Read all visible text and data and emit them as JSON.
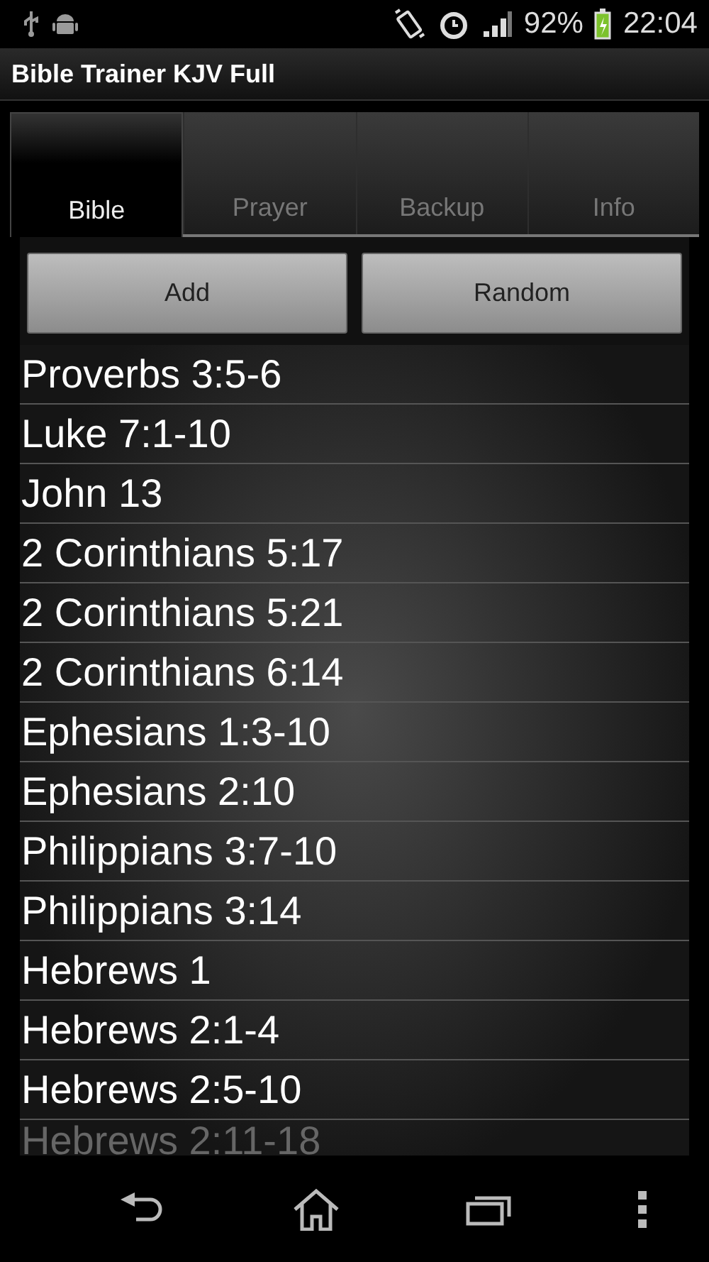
{
  "status_bar": {
    "battery": "92%",
    "time": "22:04"
  },
  "action_bar": {
    "title": "Bible Trainer KJV Full"
  },
  "tabs": [
    {
      "label": "Bible",
      "selected": true
    },
    {
      "label": "Prayer",
      "selected": false
    },
    {
      "label": "Backup",
      "selected": false
    },
    {
      "label": "Info",
      "selected": false
    }
  ],
  "buttons": [
    "Add",
    "Random"
  ],
  "verses": [
    "Proverbs 3:5-6",
    "Luke 7:1-10",
    "John 13",
    "2 Corinthians 5:17",
    "2 Corinthians 5:21",
    "2 Corinthians 6:14",
    "Ephesians 1:3-10",
    "Ephesians 2:10",
    "Philippians 3:7-10",
    "Philippians 3:14",
    "Hebrews 1",
    "Hebrews 2:1-4",
    "Hebrews 2:5-10",
    "Hebrews 2:11-18"
  ]
}
